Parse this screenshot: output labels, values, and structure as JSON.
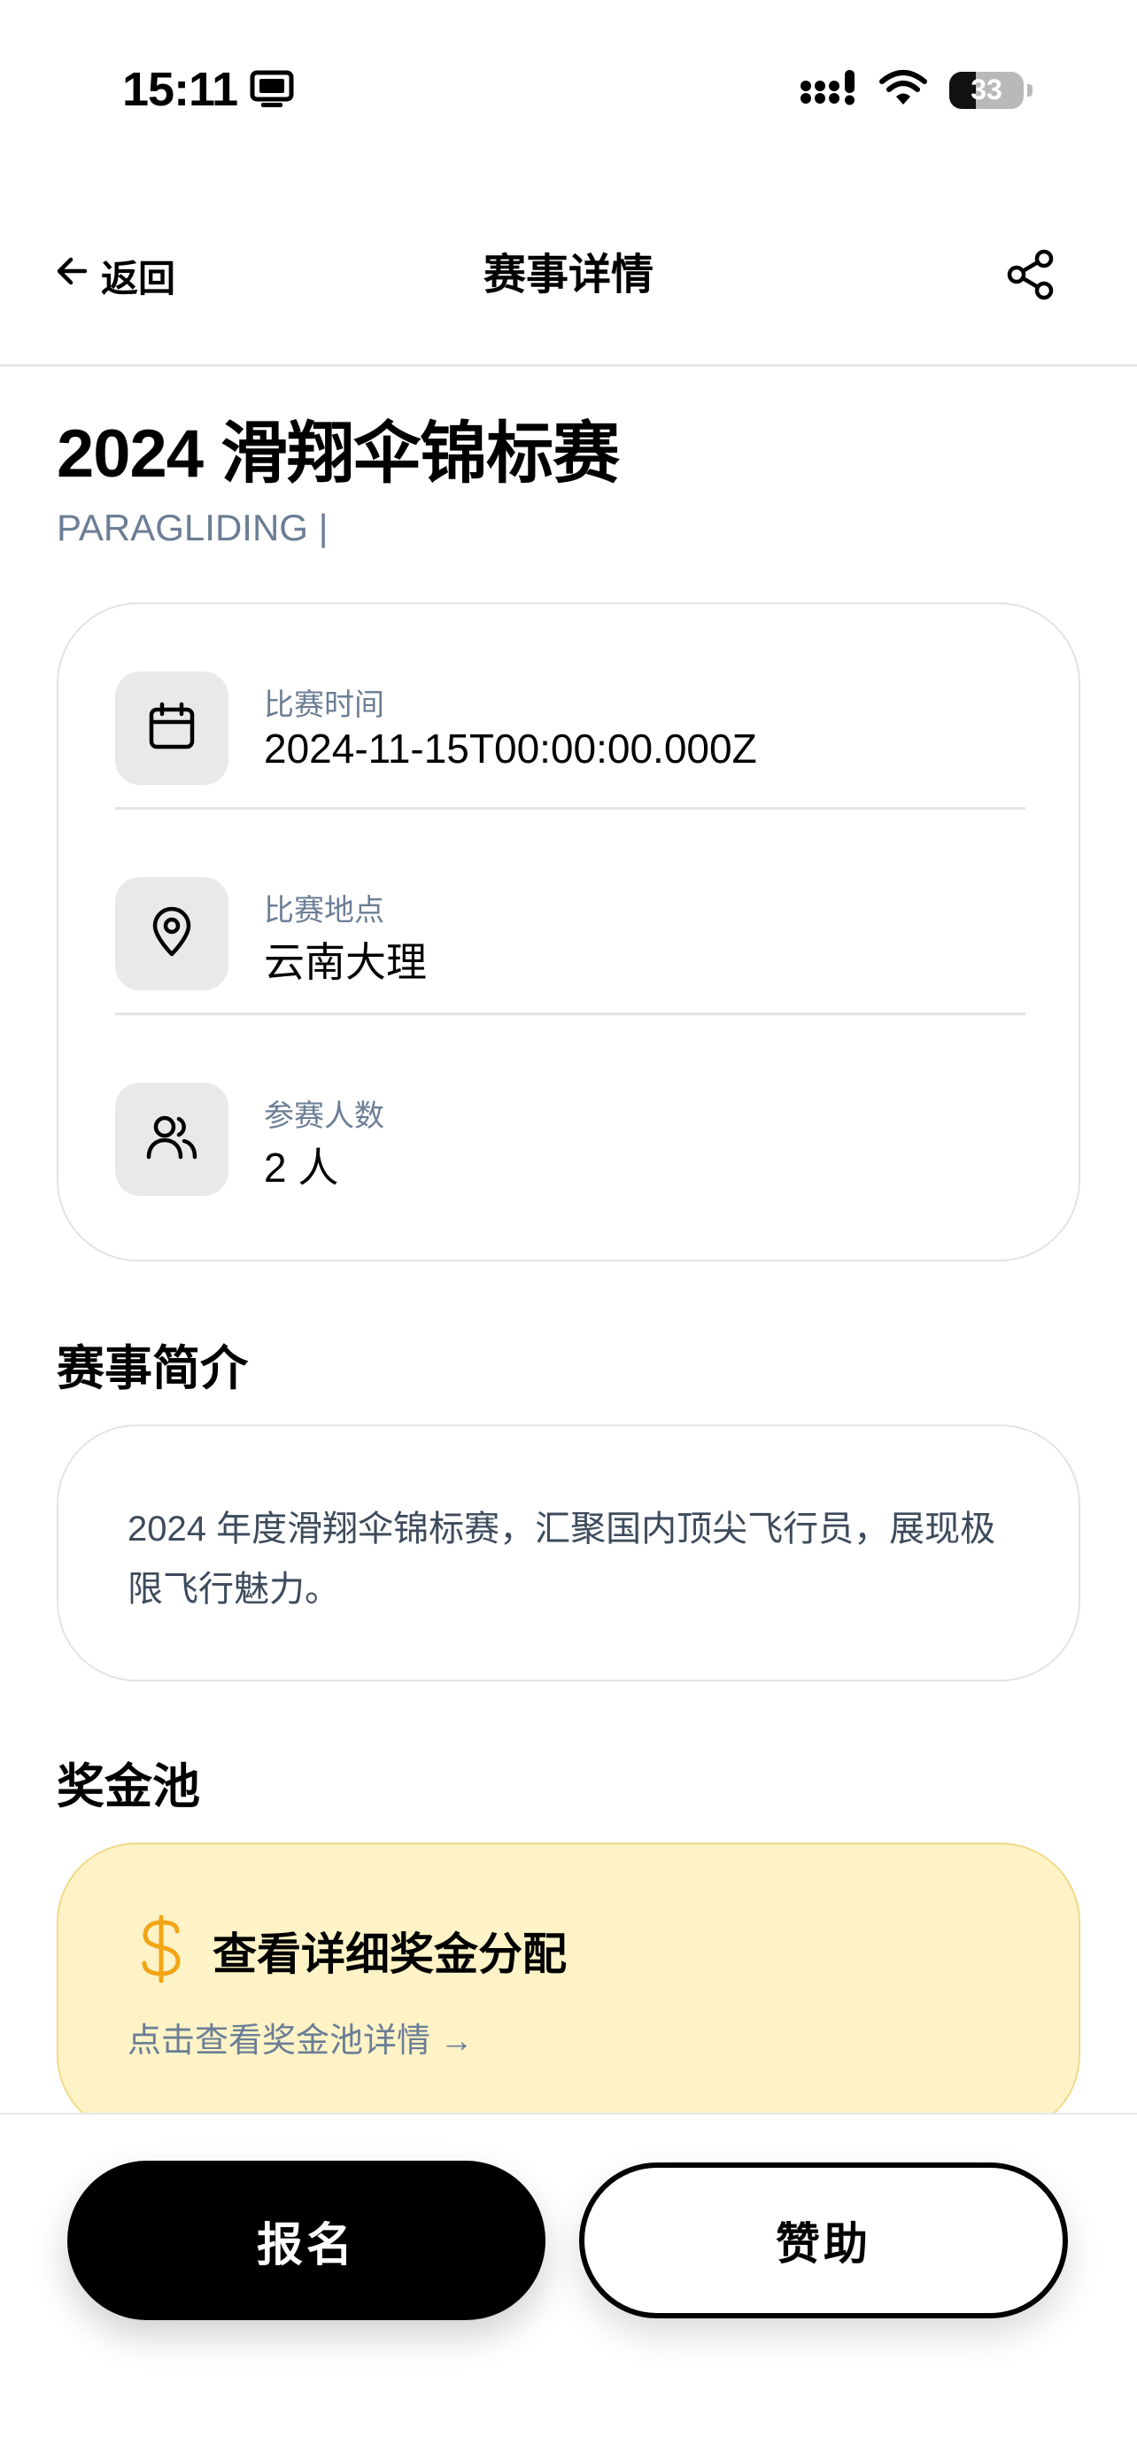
{
  "status_bar": {
    "time": "15:11",
    "battery_level": "33"
  },
  "nav": {
    "back_label": "返回",
    "title": "赛事详情"
  },
  "event": {
    "title": "2024 滑翔伞锦标赛",
    "type_label": "PARAGLIDING |"
  },
  "info": {
    "date_label": "比赛时间",
    "date_value": "2024-11-15T00:00:00.000Z",
    "location_label": "比赛地点",
    "location_value": "云南大理",
    "participants_label": "参赛人数",
    "participants_value": "2 人"
  },
  "description": {
    "section_title": "赛事简介",
    "text": "2024 年度滑翔伞锦标赛，汇聚国内顶尖飞行员，展现极限飞行魅力。"
  },
  "prize_pool": {
    "section_title": "奖金池",
    "card_title": "查看详细奖金分配",
    "card_link": "点击查看奖金池详情 →"
  },
  "actions": {
    "signup_label": "报名",
    "sponsor_label": "赞助"
  },
  "colors": {
    "accent_gold": "#f2a516",
    "prize_bg": "#fdf3c6",
    "muted_text": "#6b7e95"
  }
}
